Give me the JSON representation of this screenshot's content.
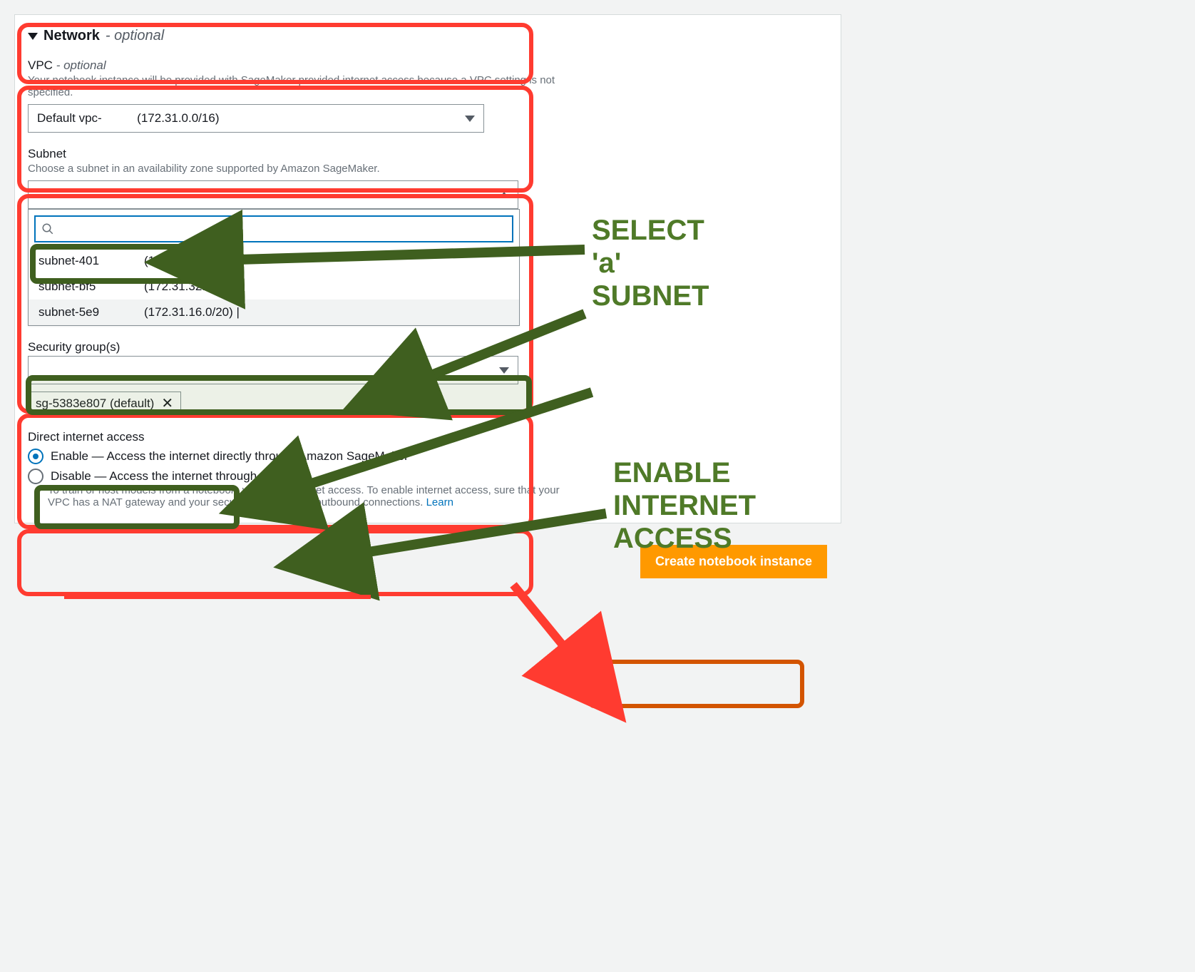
{
  "section": {
    "title": "Network",
    "optional": "- optional"
  },
  "vpc": {
    "label": "VPC",
    "optional": "- optional",
    "hint": "Your notebook instance will be provided with SageMaker provided internet access because a VPC setting is not specified.",
    "selected_prefix": "Default vpc-",
    "selected_cidr": "(172.31.0.0/16)"
  },
  "subnet": {
    "label": "Subnet",
    "hint": "Choose a subnet in an availability zone supported by Amazon SageMaker.",
    "selected": "",
    "search_placeholder": "",
    "options": [
      {
        "id": "subnet-401",
        "cidr": "(172.31.48.0/20) |"
      },
      {
        "id": "subnet-bf5",
        "cidr": "(172.31.32.0/20) |"
      },
      {
        "id": "subnet-5e9",
        "cidr": "(172.31.16.0/20) |"
      }
    ]
  },
  "sg": {
    "label": "Security group(s)",
    "selected": "",
    "chip": "sg-5383e807 (default)"
  },
  "dia": {
    "label": "Direct internet access",
    "enable": "Enable — Access the internet directly through Amazon SageMaker",
    "disable": "Disable — Access the internet through a VPC",
    "help_prefix": "To train or host models from a notebook, you need internet access. To enable internet access, sure that your VPC has a NAT gateway and your security group allows outbound connections. ",
    "learn": "Learn"
  },
  "footer": {
    "create": "Create notebook instance"
  },
  "callouts": {
    "subnet": "SELECT 'a' SUBNET",
    "internet": "ENABLE INTERNET ACCESS"
  }
}
